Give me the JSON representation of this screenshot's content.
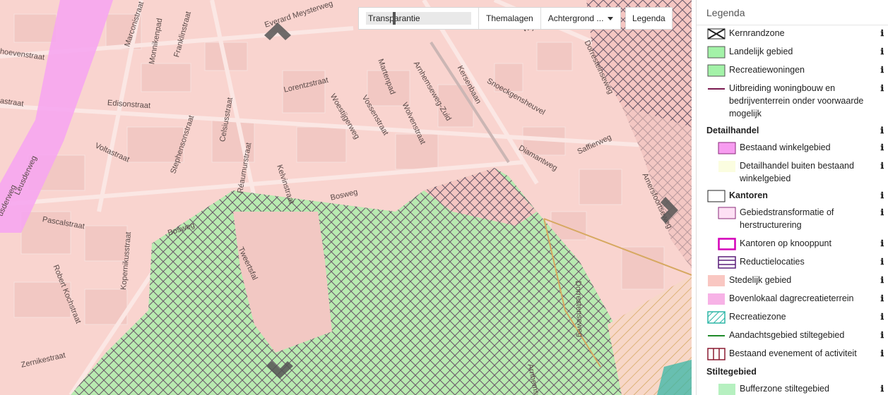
{
  "toolbar": {
    "transparency_label": "Transparantie",
    "thema_label": "Themalagen",
    "achtergrond_label": "Achtergrond ...",
    "legenda_label": "Legenda"
  },
  "map": {
    "streets": [
      "Everard Meysterweg",
      "Marconistraat",
      "Monnikenpad",
      "Franklinstraat",
      "hoevenstraat",
      "Lorentzstraat",
      "Edisonstraat",
      "astraat",
      "Celsiusstraat",
      "Stephensonstraat",
      "Voltastraat",
      "Leusderweg",
      "Woestijgerweg",
      "Vossenstraat",
      "Martenpad",
      "Wolvenstraat",
      "Arnhemseweg-Zuid",
      "Kersenbaan",
      "Snoeckgensheuvel",
      "Dorresteinseweg",
      "Diamantweg",
      "Saffierweg",
      "Réaumurstraat",
      "Kelvinstraat",
      "Bosweg",
      "Bosweg",
      "Pascalstraat",
      "usderweg",
      "Robert Kochstraat",
      "Kopernikusstraat",
      "Zernikestraat",
      "Dorrestenseweg",
      "Wijnbergh",
      "Arnhemseweg",
      "Tweertsfal",
      "Amersfoortseweg"
    ]
  },
  "legend": {
    "title": "Legenda",
    "items": [
      {
        "label": "Kernrandzone",
        "type": "item",
        "indent": false
      },
      {
        "label": "Landelijk gebied",
        "type": "item",
        "indent": false
      },
      {
        "label": "Recreatiewoningen",
        "type": "item",
        "indent": false
      },
      {
        "label": "Uitbreiding woningbouw en bedrijventerrein onder voorwaarde mogelijk",
        "type": "item",
        "indent": false
      },
      {
        "label": "Detailhandel",
        "type": "group"
      },
      {
        "label": "Bestaand winkelgebied",
        "type": "item",
        "indent": true
      },
      {
        "label": "Detailhandel buiten bestaand winkelgebied",
        "type": "item",
        "indent": true
      },
      {
        "label": "Kantoren",
        "type": "item-bold",
        "indent": false
      },
      {
        "label": "Gebiedstransformatie of herstructurering",
        "type": "item",
        "indent": true
      },
      {
        "label": "Kantoren op knooppunt",
        "type": "item",
        "indent": true
      },
      {
        "label": "Reductielocaties",
        "type": "item",
        "indent": true
      },
      {
        "label": "Stedelijk gebied",
        "type": "item",
        "indent": false
      },
      {
        "label": "Bovenlokaal dagrecreatieterrein",
        "type": "item",
        "indent": false
      },
      {
        "label": "Recreatiezone",
        "type": "item",
        "indent": false
      },
      {
        "label": "Aandachtsgebied stiltegebied",
        "type": "item",
        "indent": false
      },
      {
        "label": "Bestaand evenement of activiteit",
        "type": "item",
        "indent": false
      },
      {
        "label": "Stiltegebied",
        "type": "group"
      },
      {
        "label": "Bufferzone stiltegebied",
        "type": "item",
        "indent": true
      }
    ],
    "info_glyph": "ℹ"
  },
  "colors": {
    "urban": "#f9d4cf",
    "rural": "#b6f0b6",
    "hatch": "#6b5a6a",
    "shopping": "#f79cf0",
    "recreation_zone": "#2bb5a5",
    "accent_purple": "#7a1a50"
  }
}
